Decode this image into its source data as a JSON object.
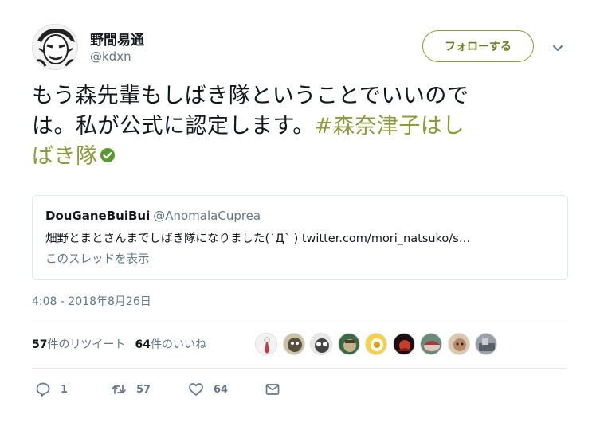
{
  "author": {
    "name": "野間易通",
    "handle": "@kdxn"
  },
  "follow_label": "フォローする",
  "tweet": {
    "text_line1": "もう森先輩もしばき隊ということでいいので",
    "text_line2_plain": "は。私が公式に認定します。",
    "hashtag_part1": "#森奈津子はし",
    "hashtag_part2": "ばき隊"
  },
  "quote": {
    "name": "DouGaneBuiBui",
    "handle": "@AnomalaCuprea",
    "text": "畑野とまとさんまでしばき隊になりました(´Д` ) twitter.com/mori_natsuko/s…",
    "thread_link": "このスレッドを表示"
  },
  "timestamp": "4:08 - 2018年8月26日",
  "stats": {
    "retweets_count": "57",
    "retweets_label": "件のリツイート",
    "likes_count": "64",
    "likes_label": "件のいいね"
  },
  "actions": {
    "reply_count": "1",
    "retweet_count": "57",
    "like_count": "64"
  },
  "colors": {
    "accent": "#8c9a3c",
    "verified": "#5b9a2e"
  }
}
